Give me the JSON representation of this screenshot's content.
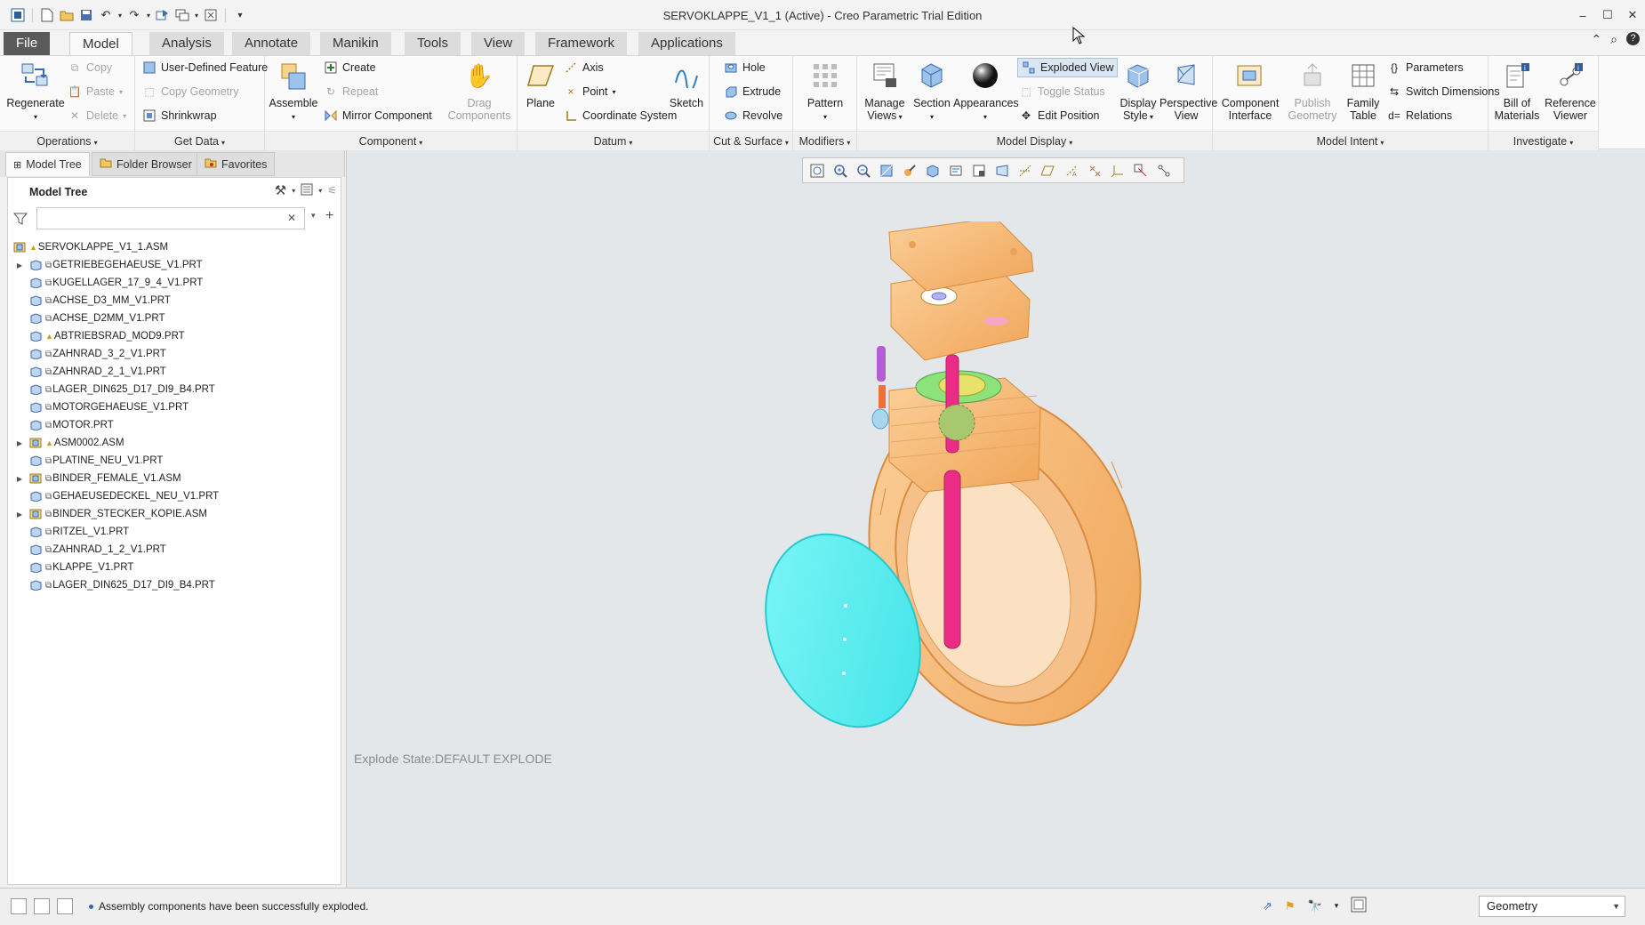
{
  "window": {
    "title": "SERVOKLAPPE_V1_1 (Active) - Creo Parametric Trial Edition",
    "controls": [
      "–",
      "☐",
      "✕"
    ]
  },
  "quick_access": [
    "▣",
    "▢",
    "▤",
    "💾",
    "↶",
    "↷",
    "⧉",
    "⧈",
    "⊠",
    "▾"
  ],
  "tabs": [
    "File",
    "Model",
    "Analysis",
    "Annotate",
    "Manikin",
    "Tools",
    "View",
    "Framework",
    "Applications"
  ],
  "active_tab": "Model",
  "ribbon": {
    "operations": {
      "label": "Operations",
      "regenerate": "Regenerate",
      "copy": "Copy",
      "paste": "Paste",
      "delete": "Delete"
    },
    "get_data": {
      "label": "Get Data",
      "user_defined_feature": "User-Defined Feature",
      "copy_geometry": "Copy Geometry",
      "shrinkwrap": "Shrinkwrap"
    },
    "component": {
      "label": "Component",
      "assemble": "Assemble",
      "create": "Create",
      "repeat": "Repeat",
      "mirror_component": "Mirror Component",
      "drag_components_1": "Drag",
      "drag_components_2": "Components"
    },
    "datum": {
      "label": "Datum",
      "plane": "Plane",
      "axis": "Axis",
      "point": "Point",
      "coordinate_system": "Coordinate System",
      "sketch": "Sketch"
    },
    "cut_surface": {
      "label": "Cut & Surface",
      "hole": "Hole",
      "extrude": "Extrude",
      "revolve": "Revolve"
    },
    "modifiers": {
      "label": "Modifiers",
      "pattern": "Pattern"
    },
    "model_display": {
      "label": "Model Display",
      "manage_views_1": "Manage",
      "manage_views_2": "Views",
      "section": "Section",
      "appearances": "Appearances",
      "exploded_view": "Exploded View",
      "toggle_status": "Toggle Status",
      "edit_position": "Edit Position",
      "display_style_1": "Display",
      "display_style_2": "Style",
      "perspective_view_1": "Perspective",
      "perspective_view_2": "View"
    },
    "model_intent": {
      "label": "Model Intent",
      "component_interface_1": "Component",
      "component_interface_2": "Interface",
      "publish_geometry_1": "Publish",
      "publish_geometry_2": "Geometry",
      "family_table_1": "Family",
      "family_table_2": "Table",
      "parameters": "Parameters",
      "switch_dimensions": "Switch Dimensions",
      "relations": "Relations"
    },
    "investigate": {
      "label": "Investigate",
      "bill_of_materials_1": "Bill of",
      "bill_of_materials_2": "Materials",
      "reference_viewer_1": "Reference",
      "reference_viewer_2": "Viewer"
    }
  },
  "left_tabs": [
    "Model Tree",
    "Folder Browser",
    "Favorites"
  ],
  "model_tree": {
    "title": "Model Tree",
    "search_placeholder": "",
    "root": "SERVOKLAPPE_V1_1.ASM",
    "items": [
      {
        "name": "GETRIEBEGEHAEUSE_V1.PRT",
        "expandable": true,
        "asm": false,
        "warn": false
      },
      {
        "name": "KUGELLAGER_17_9_4_V1.PRT",
        "expandable": false,
        "asm": false,
        "warn": false
      },
      {
        "name": "ACHSE_D3_MM_V1.PRT",
        "expandable": false,
        "asm": false,
        "warn": false
      },
      {
        "name": "ACHSE_D2MM_V1.PRT",
        "expandable": false,
        "asm": false,
        "warn": false
      },
      {
        "name": "ABTRIEBSRAD_MOD9.PRT",
        "expandable": false,
        "asm": false,
        "warn": true
      },
      {
        "name": "ZAHNRAD_3_2_V1.PRT",
        "expandable": false,
        "asm": false,
        "warn": false
      },
      {
        "name": "ZAHNRAD_2_1_V1.PRT",
        "expandable": false,
        "asm": false,
        "warn": false
      },
      {
        "name": "LAGER_DIN625_D17_DI9_B4.PRT",
        "expandable": false,
        "asm": false,
        "warn": false
      },
      {
        "name": "MOTORGEHAEUSE_V1.PRT",
        "expandable": false,
        "asm": false,
        "warn": false
      },
      {
        "name": "MOTOR.PRT",
        "expandable": false,
        "asm": false,
        "warn": false
      },
      {
        "name": "ASM0002.ASM",
        "expandable": true,
        "asm": true,
        "warn": true
      },
      {
        "name": "PLATINE_NEU_V1.PRT",
        "expandable": false,
        "asm": false,
        "warn": false
      },
      {
        "name": "BINDER_FEMALE_V1.ASM",
        "expandable": true,
        "asm": true,
        "warn": false
      },
      {
        "name": "GEHAEUSEDECKEL_NEU_V1.PRT",
        "expandable": false,
        "asm": false,
        "warn": false
      },
      {
        "name": "BINDER_STECKER_KOPIE.ASM",
        "expandable": true,
        "asm": true,
        "warn": false
      },
      {
        "name": "RITZEL_V1.PRT",
        "expandable": false,
        "asm": false,
        "warn": false
      },
      {
        "name": "ZAHNRAD_1_2_V1.PRT",
        "expandable": false,
        "asm": false,
        "warn": false
      },
      {
        "name": "KLAPPE_V1.PRT",
        "expandable": false,
        "asm": false,
        "warn": false
      },
      {
        "name": "LAGER_DIN625_D17_DI9_B4.PRT",
        "expandable": false,
        "asm": false,
        "warn": false
      }
    ]
  },
  "viewport": {
    "explode_state": "Explode State:DEFAULT EXPLODE"
  },
  "status": {
    "message": "Assembly components have been successfully exploded.",
    "filter_value": "Geometry"
  },
  "colors": {
    "model_orange": "#f7b678",
    "model_cyan": "#5ff0f0",
    "model_pink": "#ea2c87",
    "viewport_bg": "#e4e7ea"
  }
}
